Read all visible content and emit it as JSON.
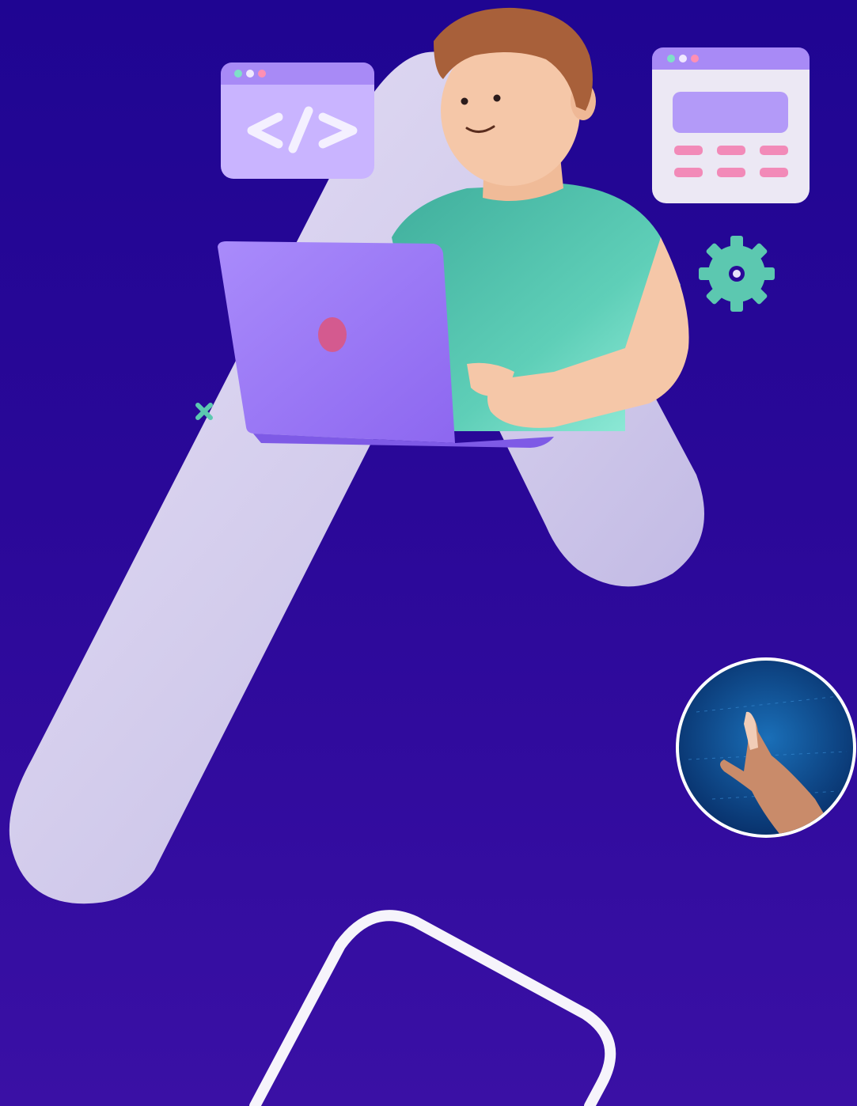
{
  "illustration": {
    "background_colors": [
      "#1f0592",
      "#3a10a5"
    ],
    "icons": {
      "code_window": "code-window-icon",
      "calculator_window": "calculator-window-icon",
      "gear": "gear-icon",
      "sparkle": "sparkle-icon",
      "touch_photo": "touch-hand-photo"
    },
    "accent_colors": {
      "lavender_band": "#cfc8ea",
      "laptop": "#9c79f7",
      "shirt": "#5fcfb8",
      "gear": "#5cc8b0",
      "hair": "#a8603a",
      "skin": "#f5c7a8"
    }
  }
}
